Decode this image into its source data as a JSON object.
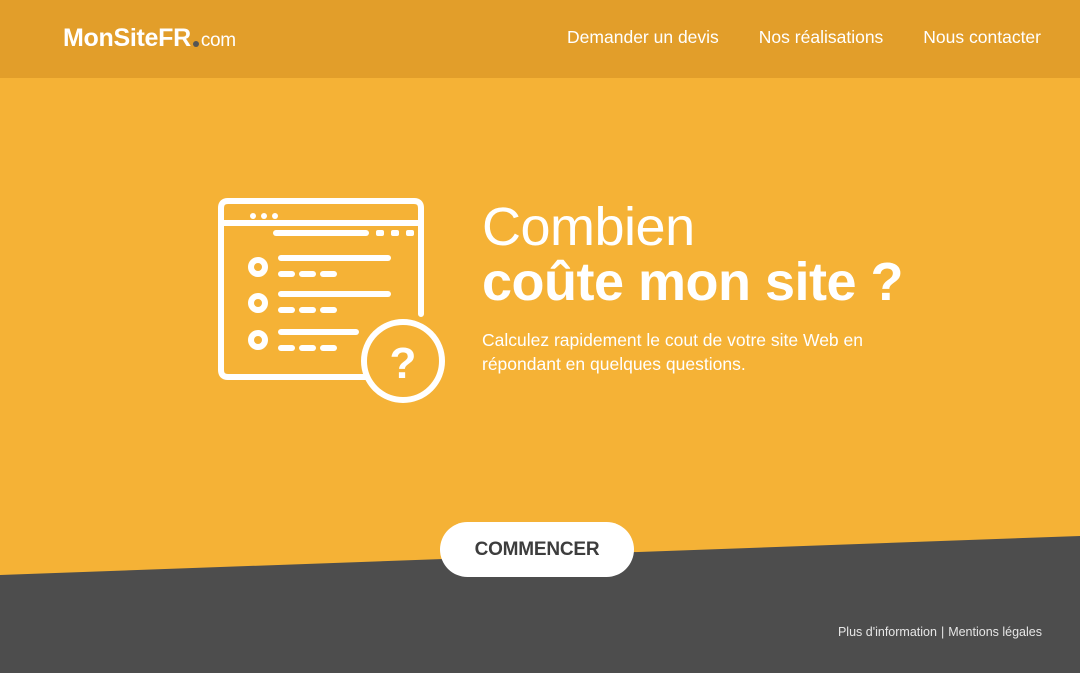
{
  "header": {
    "logo_main": "MonSiteFR",
    "logo_tld": "com",
    "nav": [
      {
        "label": "Demander un devis"
      },
      {
        "label": "Nos réalisations"
      },
      {
        "label": "Nous contacter"
      }
    ]
  },
  "hero": {
    "title_line1": "Combien",
    "title_line2": "coûte mon site ?",
    "subtitle": "Calculez rapidement le cout de votre site Web en répondant en quelques questions.",
    "illustration_icon": "quote-form-question-icon",
    "question_mark": "?"
  },
  "cta": {
    "label": "COMMENCER"
  },
  "footer": {
    "link_info": "Plus d'information",
    "separator": "|",
    "link_legal": "Mentions légales"
  },
  "colors": {
    "header_bg": "#e29e2a",
    "hero_bg": "#f5b236",
    "footer_bg": "#4d4d4d",
    "button_bg": "#ffffff",
    "button_text": "#3d3d3d"
  }
}
